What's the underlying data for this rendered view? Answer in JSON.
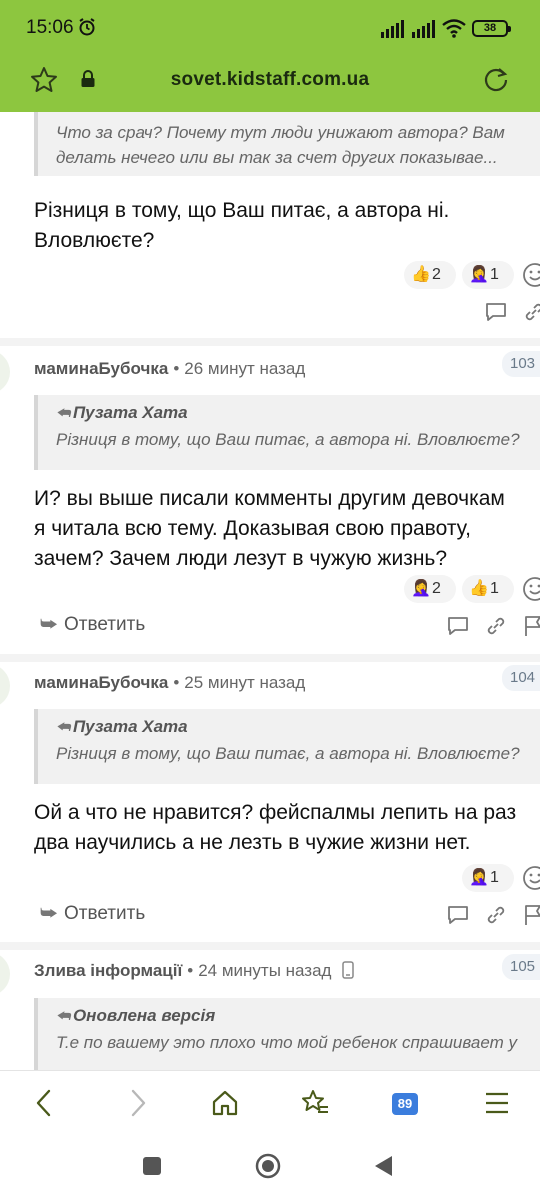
{
  "status_bar": {
    "time": "15:06",
    "battery": "38"
  },
  "address_bar": {
    "url": "sovet.kidstaff.com.ua"
  },
  "top_partial": {
    "quote_lines": [
      "Что за срач? Почему тут люди унижают автора? Вам",
      "делать нечего или вы так за счет других показывае..."
    ],
    "body_lines": [
      "Різниця в тому, що Ваш питає, а автора ні.",
      "Вловлюєте?"
    ],
    "reactions": [
      {
        "emoji": "👍",
        "count": "2"
      },
      {
        "emoji": "🤦‍♀️",
        "count": "1"
      }
    ]
  },
  "posts": [
    {
      "author": "маминаБубочка",
      "time": "26 минут назад",
      "number": "103",
      "quote_author": "Пузата Хата",
      "quote_lines": [
        "Різниця в тому, що Ваш питає, а автора ні. Вловлюєте?"
      ],
      "body_lines": [
        "И? вы выше писали комменты другим девочкам",
        "я читала всю тему. Доказывая свою правоту,",
        "зачем? Зачем люди лезут в чужую жизнь?"
      ],
      "reactions": [
        {
          "emoji": "🤦‍♀️",
          "count": "2"
        },
        {
          "emoji": "👍",
          "count": "1"
        }
      ],
      "reply_label": "Ответить"
    },
    {
      "author": "маминаБубочка",
      "time": "25 минут назад",
      "number": "104",
      "quote_author": "Пузата Хата",
      "quote_lines": [
        "Різниця в тому, що Ваш питає, а автора ні. Вловлюєте?"
      ],
      "body_lines": [
        "Ой а что не нравится? фейспалмы лепить на раз",
        "два научились а не лезть в чужие жизни нет."
      ],
      "reactions": [
        {
          "emoji": "🤦‍♀️",
          "count": "1"
        }
      ],
      "reply_label": "Ответить"
    },
    {
      "author": "Злива інформації",
      "time": "24 минуты назад",
      "number": "105",
      "quote_author": "Оновлена версія",
      "quote_lines": [
        "Т.е по вашему это плохо что мой ребенок спрашивает у"
      ]
    }
  ],
  "bottom_bar": {
    "tabs_count": "89"
  },
  "colors": {
    "toolbar": "#8dc63f",
    "accent_blue": "#3b7ddd"
  }
}
